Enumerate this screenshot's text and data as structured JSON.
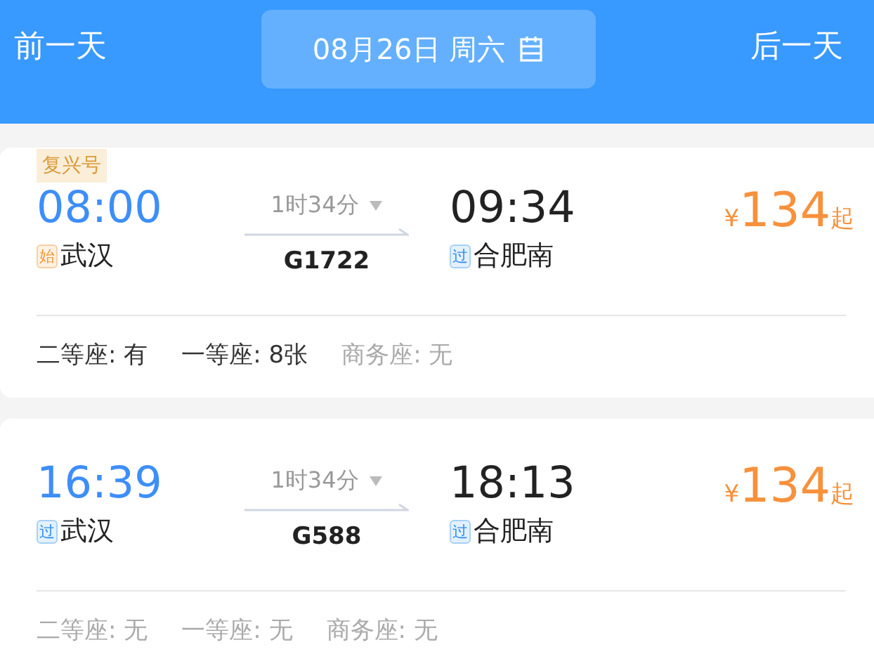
{
  "header": {
    "prev_day": "前一天",
    "date": "08月26日 周六",
    "next_day": "后一天"
  },
  "trains": [
    {
      "tag": "复兴号",
      "depart_time": "08:00",
      "depart_station": {
        "kind": "start",
        "badge": "始",
        "name": "武汉"
      },
      "duration": "1时34分",
      "train_no": "G1722",
      "arrive_time": "09:34",
      "arrive_station": {
        "kind": "pass",
        "badge": "过",
        "name": "合肥南"
      },
      "currency": "¥",
      "price": "134",
      "price_suffix": "起",
      "seats": [
        {
          "label": "二等座:",
          "value": "有",
          "available": true
        },
        {
          "label": "一等座:",
          "value": "8张",
          "available": true
        },
        {
          "label": "商务座:",
          "value": "无",
          "available": false
        }
      ]
    },
    {
      "depart_time": "16:39",
      "depart_station": {
        "kind": "pass",
        "badge": "过",
        "name": "武汉"
      },
      "duration": "1时34分",
      "train_no": "G588",
      "arrive_time": "18:13",
      "arrive_station": {
        "kind": "pass",
        "badge": "过",
        "name": "合肥南"
      },
      "currency": "¥",
      "price": "134",
      "price_suffix": "起",
      "seats": [
        {
          "label": "二等座:",
          "value": "无",
          "available": false
        },
        {
          "label": "一等座:",
          "value": "无",
          "available": false
        },
        {
          "label": "商务座:",
          "value": "无",
          "available": false
        }
      ]
    }
  ]
}
